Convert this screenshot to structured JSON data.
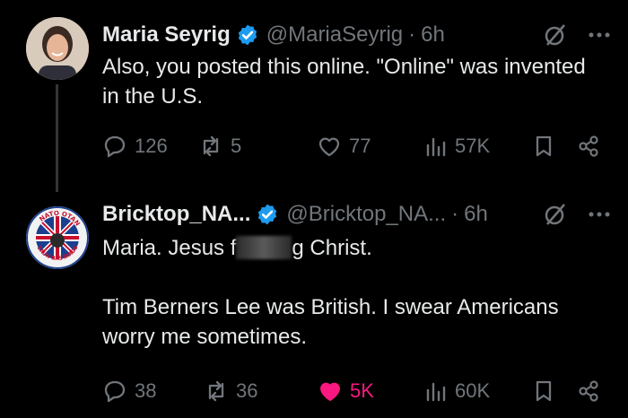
{
  "tweets": [
    {
      "name": "Maria Seyrig",
      "handle": "@MariaSeyrig",
      "time": "6h",
      "paragraphs": [
        "Also, you posted this online. \"Online\" was invented in the U.S."
      ],
      "replies": "126",
      "reposts": "5",
      "likes": "77",
      "views": "57K",
      "liked": false
    },
    {
      "name": "Bricktop_NA...",
      "handle": "@Bricktop_NA...",
      "time": "6h",
      "text_before_censor": "Maria. Jesus f",
      "text_after_censor": "g Christ.",
      "paragraphs": [
        "Tim Berners Lee was British. I swear Americans worry me sometimes."
      ],
      "replies": "38",
      "reposts": "36",
      "likes": "5K",
      "views": "60K",
      "liked": true,
      "avatar_badge_text_top": "NATO OTAN",
      "avatar_badge_text_bottom": "SAUN BASTARDS"
    }
  ],
  "colors": {
    "background": "#000000",
    "text": "#e7e9ea",
    "muted": "#71767b",
    "verified": "#1d9bf0",
    "like": "#f91880"
  },
  "icons": [
    "verified-badge-icon",
    "grok-icon",
    "more-icon",
    "reply-icon",
    "repost-icon",
    "like-icon",
    "views-icon",
    "bookmark-icon",
    "share-icon"
  ]
}
